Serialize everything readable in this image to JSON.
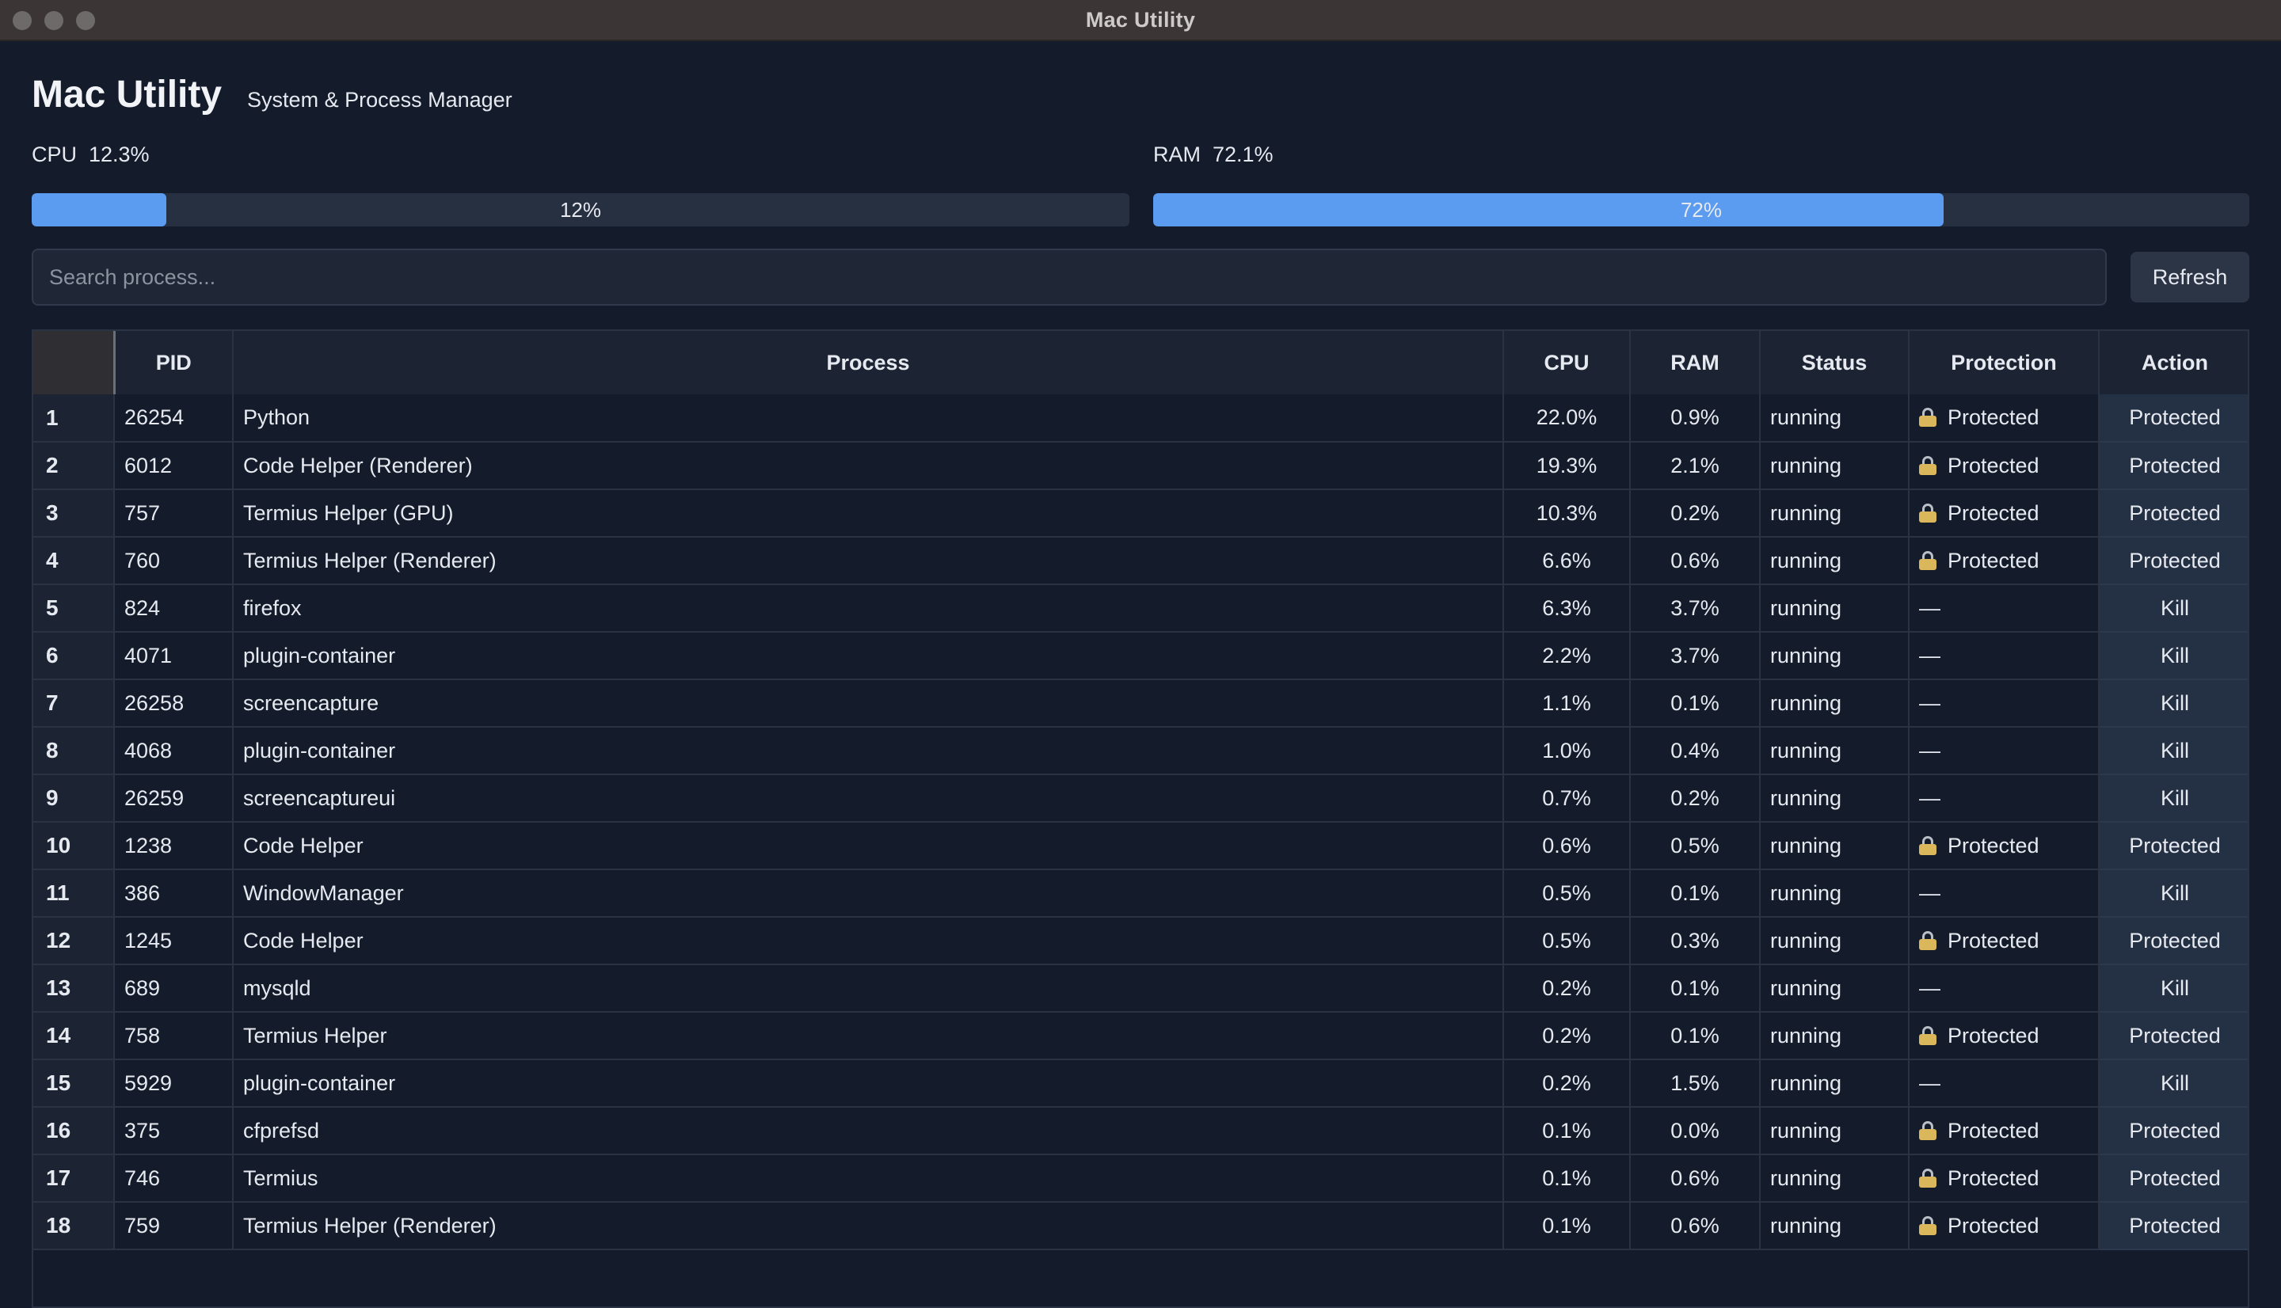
{
  "window": {
    "title": "Mac Utility"
  },
  "header": {
    "title": "Mac Utility",
    "subtitle": "System & Process Manager"
  },
  "cpu": {
    "label": "CPU  12.3%",
    "percent_text": "12%",
    "fraction": 0.123
  },
  "ram": {
    "label": "RAM  72.1%",
    "percent_text": "72%",
    "fraction": 0.721
  },
  "search": {
    "placeholder": "Search process...",
    "value": ""
  },
  "refresh_label": "Refresh",
  "table": {
    "columns": [
      "PID",
      "Process",
      "CPU",
      "RAM",
      "Status",
      "Protection",
      "Action"
    ],
    "rows": [
      {
        "n": "1",
        "pid": "26254",
        "name": "Python",
        "cpu": "22.0%",
        "ram": "0.9%",
        "status": "running",
        "protection": "Protected",
        "protected": true,
        "action": "Protected"
      },
      {
        "n": "2",
        "pid": "6012",
        "name": "Code Helper (Renderer)",
        "cpu": "19.3%",
        "ram": "2.1%",
        "status": "running",
        "protection": "Protected",
        "protected": true,
        "action": "Protected"
      },
      {
        "n": "3",
        "pid": "757",
        "name": "Termius Helper (GPU)",
        "cpu": "10.3%",
        "ram": "0.2%",
        "status": "running",
        "protection": "Protected",
        "protected": true,
        "action": "Protected"
      },
      {
        "n": "4",
        "pid": "760",
        "name": "Termius Helper (Renderer)",
        "cpu": "6.6%",
        "ram": "0.6%",
        "status": "running",
        "protection": "Protected",
        "protected": true,
        "action": "Protected"
      },
      {
        "n": "5",
        "pid": "824",
        "name": "firefox",
        "cpu": "6.3%",
        "ram": "3.7%",
        "status": "running",
        "protection": "—",
        "protected": false,
        "action": "Kill"
      },
      {
        "n": "6",
        "pid": "4071",
        "name": "plugin-container",
        "cpu": "2.2%",
        "ram": "3.7%",
        "status": "running",
        "protection": "—",
        "protected": false,
        "action": "Kill"
      },
      {
        "n": "7",
        "pid": "26258",
        "name": "screencapture",
        "cpu": "1.1%",
        "ram": "0.1%",
        "status": "running",
        "protection": "—",
        "protected": false,
        "action": "Kill"
      },
      {
        "n": "8",
        "pid": "4068",
        "name": "plugin-container",
        "cpu": "1.0%",
        "ram": "0.4%",
        "status": "running",
        "protection": "—",
        "protected": false,
        "action": "Kill"
      },
      {
        "n": "9",
        "pid": "26259",
        "name": "screencaptureui",
        "cpu": "0.7%",
        "ram": "0.2%",
        "status": "running",
        "protection": "—",
        "protected": false,
        "action": "Kill"
      },
      {
        "n": "10",
        "pid": "1238",
        "name": "Code Helper",
        "cpu": "0.6%",
        "ram": "0.5%",
        "status": "running",
        "protection": "Protected",
        "protected": true,
        "action": "Protected"
      },
      {
        "n": "11",
        "pid": "386",
        "name": "WindowManager",
        "cpu": "0.5%",
        "ram": "0.1%",
        "status": "running",
        "protection": "—",
        "protected": false,
        "action": "Kill"
      },
      {
        "n": "12",
        "pid": "1245",
        "name": "Code Helper",
        "cpu": "0.5%",
        "ram": "0.3%",
        "status": "running",
        "protection": "Protected",
        "protected": true,
        "action": "Protected"
      },
      {
        "n": "13",
        "pid": "689",
        "name": "mysqld",
        "cpu": "0.2%",
        "ram": "0.1%",
        "status": "running",
        "protection": "—",
        "protected": false,
        "action": "Kill"
      },
      {
        "n": "14",
        "pid": "758",
        "name": "Termius Helper",
        "cpu": "0.2%",
        "ram": "0.1%",
        "status": "running",
        "protection": "Protected",
        "protected": true,
        "action": "Protected"
      },
      {
        "n": "15",
        "pid": "5929",
        "name": "plugin-container",
        "cpu": "0.2%",
        "ram": "1.5%",
        "status": "running",
        "protection": "—",
        "protected": false,
        "action": "Kill"
      },
      {
        "n": "16",
        "pid": "375",
        "name": "cfprefsd",
        "cpu": "0.1%",
        "ram": "0.0%",
        "status": "running",
        "protection": "Protected",
        "protected": true,
        "action": "Protected"
      },
      {
        "n": "17",
        "pid": "746",
        "name": "Termius",
        "cpu": "0.1%",
        "ram": "0.6%",
        "status": "running",
        "protection": "Protected",
        "protected": true,
        "action": "Protected"
      },
      {
        "n": "18",
        "pid": "759",
        "name": "Termius Helper (Renderer)",
        "cpu": "0.1%",
        "ram": "0.6%",
        "status": "running",
        "protection": "Protected",
        "protected": true,
        "action": "Protected"
      }
    ]
  },
  "colors": {
    "accent": "#5b9cf0",
    "background": "#141b2b",
    "lock": "#d9b75a"
  },
  "icons": {
    "protected": "lock-icon"
  }
}
